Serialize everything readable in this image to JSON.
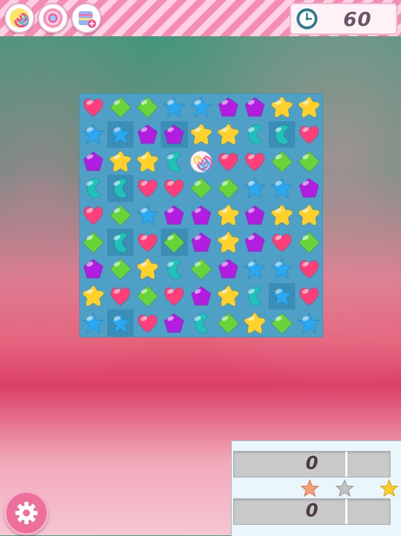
{
  "powerups": [
    {
      "name": "swirl-lollipop-icon"
    },
    {
      "name": "cupcake-icon"
    },
    {
      "name": "stripe-card-plus-icon"
    }
  ],
  "timer": {
    "icon": "clock-icon",
    "value": "60"
  },
  "board": {
    "rows": 9,
    "cols": 9,
    "colors": {
      "heart": "#ff3f7a",
      "diamond": "#69d43a",
      "star": "#2aa8f2",
      "pentagon": "#b21ee0",
      "yellow": "#ffd12a",
      "bean": "#1fc2b8"
    },
    "grid": [
      [
        "heart",
        "diamond",
        "diamond",
        "star",
        "star",
        "pentagon",
        "pentagon",
        "yellow",
        "yellow"
      ],
      [
        "star",
        "star",
        "pentagon",
        "pentagon",
        "yellow",
        "yellow",
        "bean",
        "bean",
        "heart"
      ],
      [
        "pentagon",
        "yellow",
        "yellow",
        "bean",
        "swirl",
        "heart",
        "heart",
        "diamond",
        "diamond"
      ],
      [
        "bean",
        "bean",
        "heart",
        "heart",
        "diamond",
        "diamond",
        "star",
        "star",
        "pentagon"
      ],
      [
        "heart",
        "diamond",
        "star",
        "pentagon",
        "pentagon",
        "yellow",
        "pentagon",
        "yellow",
        "yellow"
      ],
      [
        "diamond",
        "bean",
        "heart",
        "diamond",
        "pentagon",
        "yellow",
        "pentagon",
        "heart",
        "diamond"
      ],
      [
        "pentagon",
        "diamond",
        "yellow",
        "bean",
        "diamond",
        "pentagon",
        "star",
        "star",
        "heart"
      ],
      [
        "yellow",
        "heart",
        "diamond",
        "heart",
        "pentagon",
        "yellow",
        "bean",
        "star",
        "heart"
      ],
      [
        "star",
        "star",
        "heart",
        "pentagon",
        "bean",
        "diamond",
        "yellow",
        "diamond",
        "star"
      ]
    ],
    "highlights": [
      [
        1,
        1
      ],
      [
        1,
        3
      ],
      [
        1,
        7
      ],
      [
        3,
        1
      ],
      [
        5,
        1
      ],
      [
        5,
        3
      ],
      [
        7,
        7
      ],
      [
        8,
        1
      ]
    ]
  },
  "score": {
    "player": "0",
    "opponent": "0",
    "player_fill": 0,
    "opponent_fill": 0,
    "stars": [
      {
        "name": "bronze-star-icon",
        "color": "#f4a17c"
      },
      {
        "name": "silver-star-icon",
        "color": "#c3c3c3"
      },
      {
        "name": "gold-star-icon",
        "color": "#f6cf2d"
      }
    ]
  },
  "settings": {
    "icon": "gear-icon"
  }
}
